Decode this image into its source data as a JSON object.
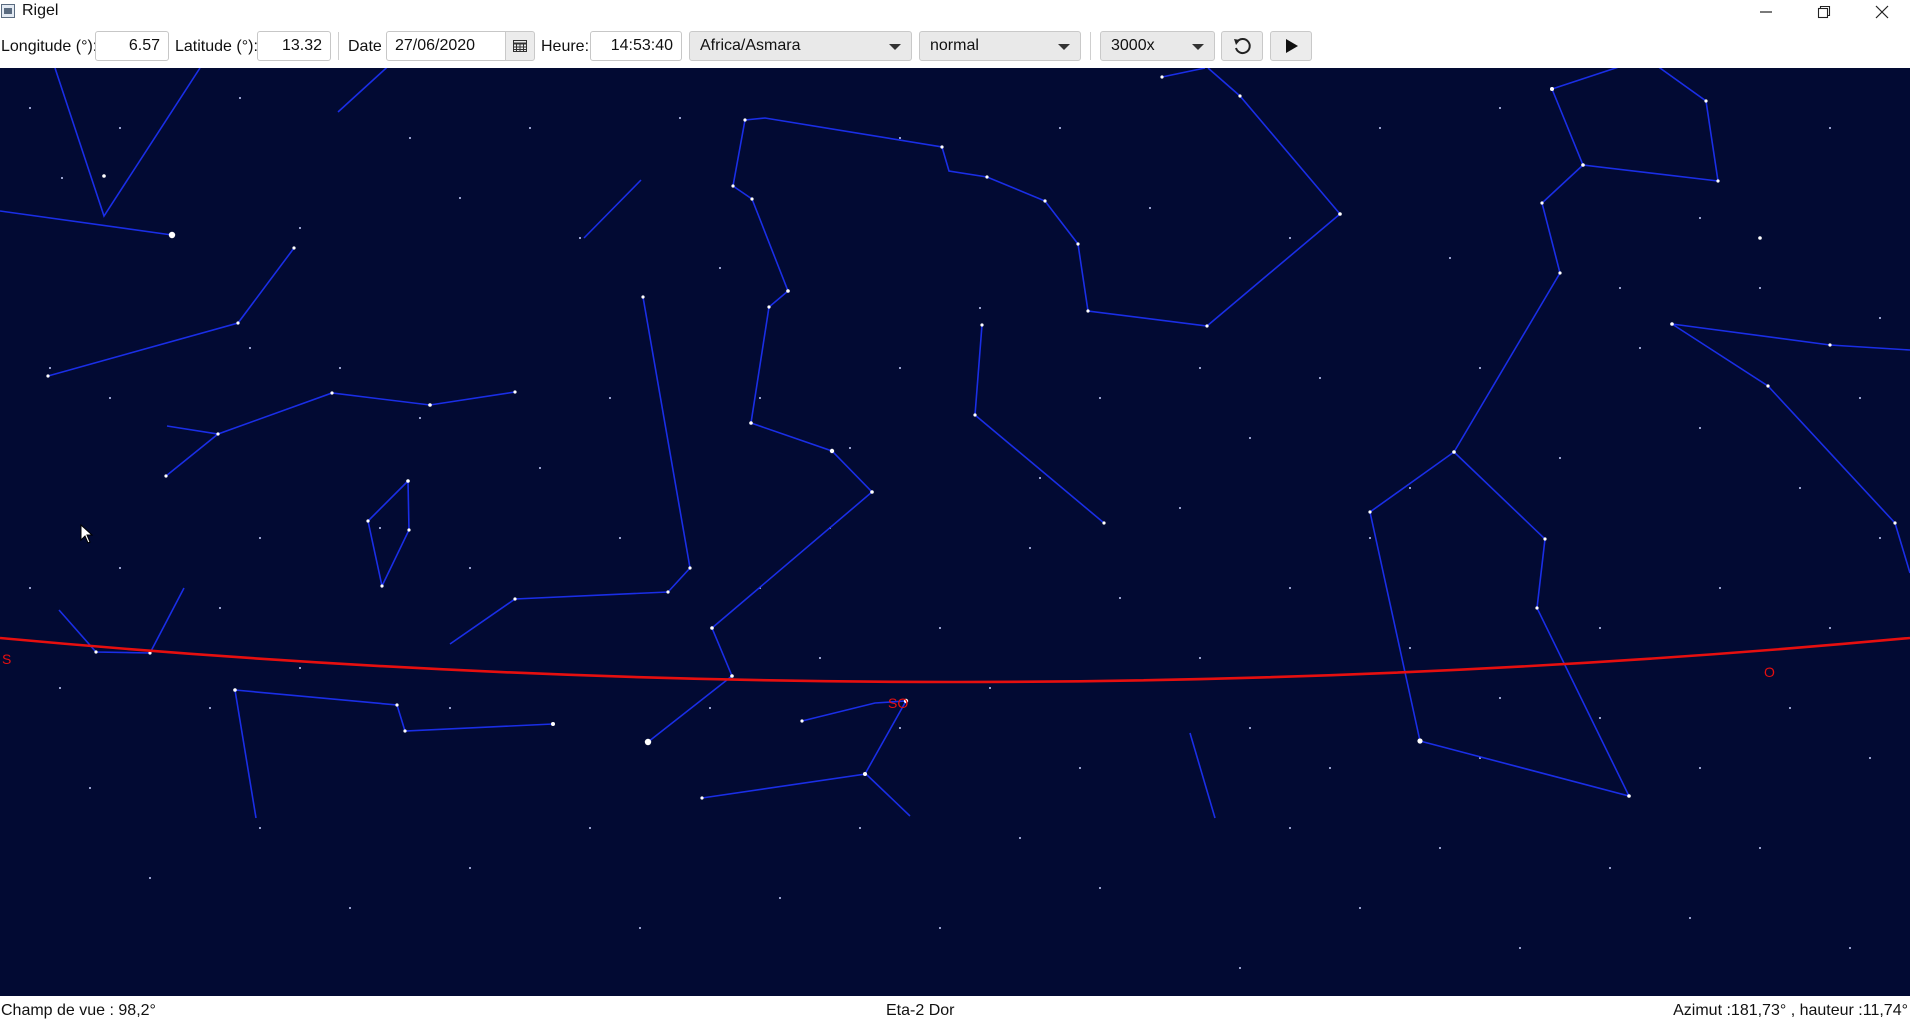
{
  "window": {
    "title": "Rigel"
  },
  "toolbar": {
    "longitude_label": "Longitude (°):",
    "longitude_value": "6.57",
    "latitude_label": "Latitude (°):",
    "latitude_value": "13.32",
    "date_label": "Date",
    "date_value": "27/06/2020",
    "time_label": "Heure:",
    "time_value": "14:53:40",
    "timezone_value": "Africa/Asmara",
    "mode_value": "normal",
    "speed_value": "3000x"
  },
  "sky": {
    "background_color": "#020a33",
    "constellation_color": "#1a2ee6",
    "horizon_color": "#e60f0f",
    "cardinal_labels": {
      "south": "S",
      "southwest": "SO",
      "west": "O"
    }
  },
  "status": {
    "field_of_view": "Champ de vue : 98,2°",
    "selected_object": "Eta-2 Dor",
    "coordinates": "Azimut :181,73° , hauteur :11,74°"
  }
}
